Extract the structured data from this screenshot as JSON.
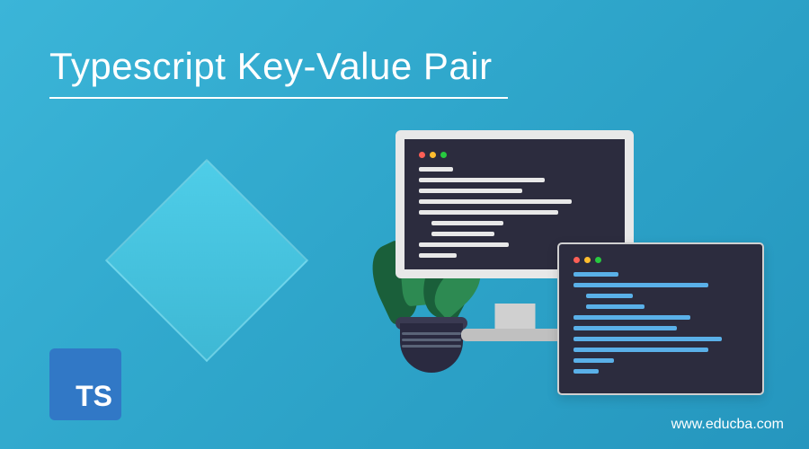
{
  "title": "Typescript Key-Value Pair",
  "badge": {
    "text": "TS"
  },
  "url": "www.educba.com"
}
